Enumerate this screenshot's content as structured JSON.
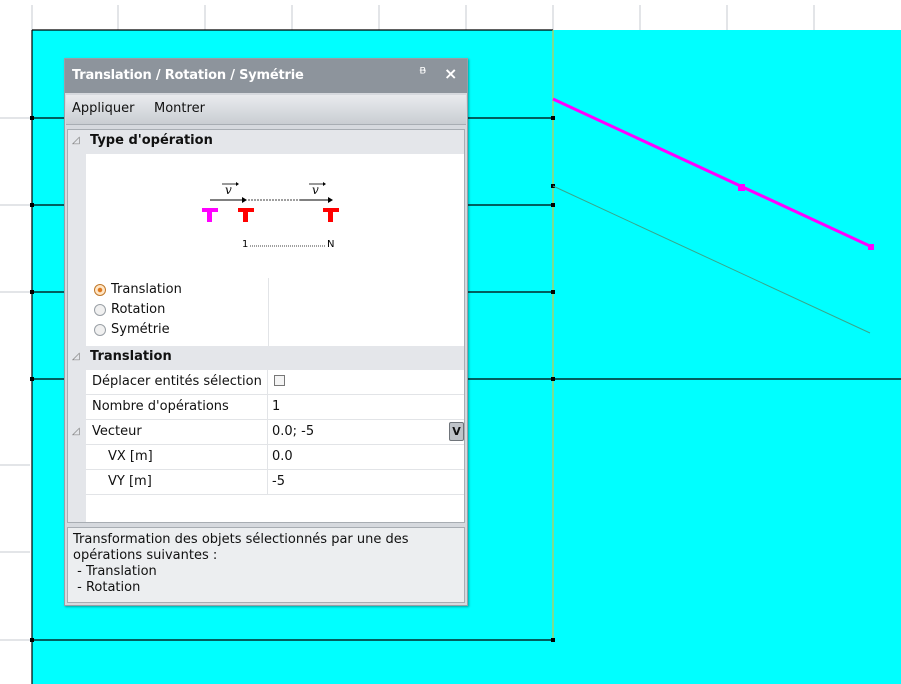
{
  "colors": {
    "viewport_bg": "#00ffff",
    "guide_line": "#c8c84a",
    "magenta_line": "#ff00ff",
    "green_line": "#3aa58a",
    "structure_line": "#000000",
    "panel_title_bg": "#8d949c"
  },
  "panel": {
    "title": "Translation / Rotation / Symétrie",
    "pin_icon": "Ꮤ",
    "close_icon": "×",
    "menu": {
      "apply": "Appliquer",
      "show": "Montrer"
    }
  },
  "operation_section": {
    "title": "Type d'opération",
    "diagram": {
      "vector1": "v",
      "vector2": "v",
      "index_start": "1",
      "index_end": "N"
    },
    "options": [
      {
        "label": "Translation",
        "selected": true
      },
      {
        "label": "Rotation",
        "selected": false
      },
      {
        "label": "Symétrie",
        "selected": false
      }
    ]
  },
  "translation_section": {
    "title": "Translation",
    "move_selected_label": "Déplacer entités sélectionnées",
    "move_selected_checked": false,
    "operations_label": "Nombre d'opérations",
    "operations_value": "1",
    "vector_label": "Vecteur",
    "vector_value": "0.0; -5",
    "vector_button": "V",
    "vx_label": "VX [m]",
    "vx_value": "0.0",
    "vy_label": "VY [m]",
    "vy_value": "-5"
  },
  "description": {
    "text": "Transformation des objets sélectionnés par une des\nopérations suivantes :\n - Translation\n - Rotation"
  }
}
